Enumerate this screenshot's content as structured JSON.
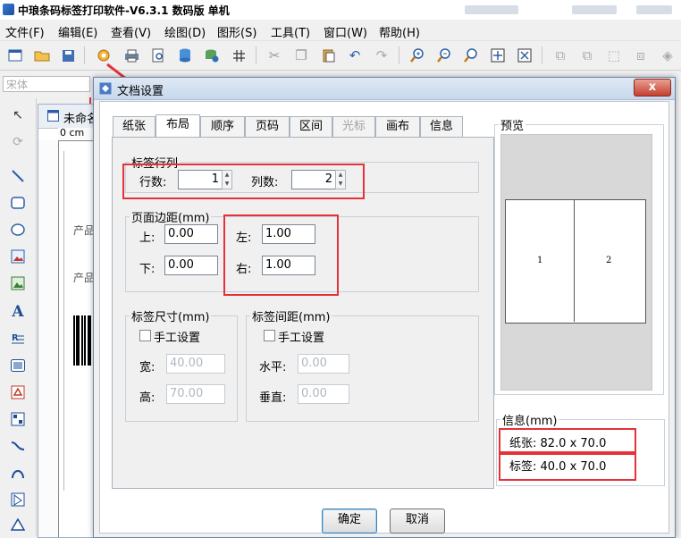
{
  "app": {
    "title": "中琅条码标签打印软件-V6.3.1 数码版 单机"
  },
  "menu": [
    {
      "label": "文件(F)"
    },
    {
      "label": "编辑(E)"
    },
    {
      "label": "查看(V)"
    },
    {
      "label": "绘图(D)"
    },
    {
      "label": "图形(S)"
    },
    {
      "label": "工具(T)"
    },
    {
      "label": "窗口(W)"
    },
    {
      "label": "帮助(H)"
    }
  ],
  "font_box": {
    "value": "宋体"
  },
  "document": {
    "tab_title": "未命名",
    "ruler_label": "0 cm",
    "field_label_1": "产品",
    "field_label_2": "产品"
  },
  "dialog": {
    "title": "文档设置",
    "close": "x",
    "tabs": [
      {
        "label": "纸张"
      },
      {
        "label": "布局",
        "active": true
      },
      {
        "label": "顺序"
      },
      {
        "label": "页码"
      },
      {
        "label": "区间"
      },
      {
        "label": "光标",
        "disabled": true
      },
      {
        "label": "画布"
      },
      {
        "label": "信息"
      }
    ],
    "rows_cols": {
      "legend": "标签行列",
      "rows_label": "行数:",
      "rows_value": "1",
      "cols_label": "列数:",
      "cols_value": "2"
    },
    "margins": {
      "legend": "页面边距(mm)",
      "top_label": "上:",
      "top_value": "0.00",
      "bottom_label": "下:",
      "bottom_value": "0.00",
      "left_label": "左:",
      "left_value": "1.00",
      "right_label": "右:",
      "right_value": "1.00"
    },
    "label_size": {
      "legend": "标签尺寸(mm)",
      "manual": "手工设置",
      "width_label": "宽:",
      "width_value": "40.00",
      "height_label": "高:",
      "height_value": "70.00"
    },
    "label_gap": {
      "legend": "标签间距(mm)",
      "manual": "手工设置",
      "horizontal_label": "水平:",
      "horizontal_value": "0.00",
      "vertical_label": "垂直:",
      "vertical_value": "0.00"
    },
    "preview": {
      "legend": "预览",
      "cell_1": "1",
      "cell_2": "2"
    },
    "info": {
      "legend": "信息(mm)",
      "paper": "纸张: 82.0 x 70.0",
      "label": "标签: 40.0 x 70.0"
    },
    "ok": "确定",
    "cancel": "取消"
  },
  "colors": {
    "highlight": "#e53238",
    "dialog_border": "#6d87a9",
    "close_button": "#c4402f"
  }
}
